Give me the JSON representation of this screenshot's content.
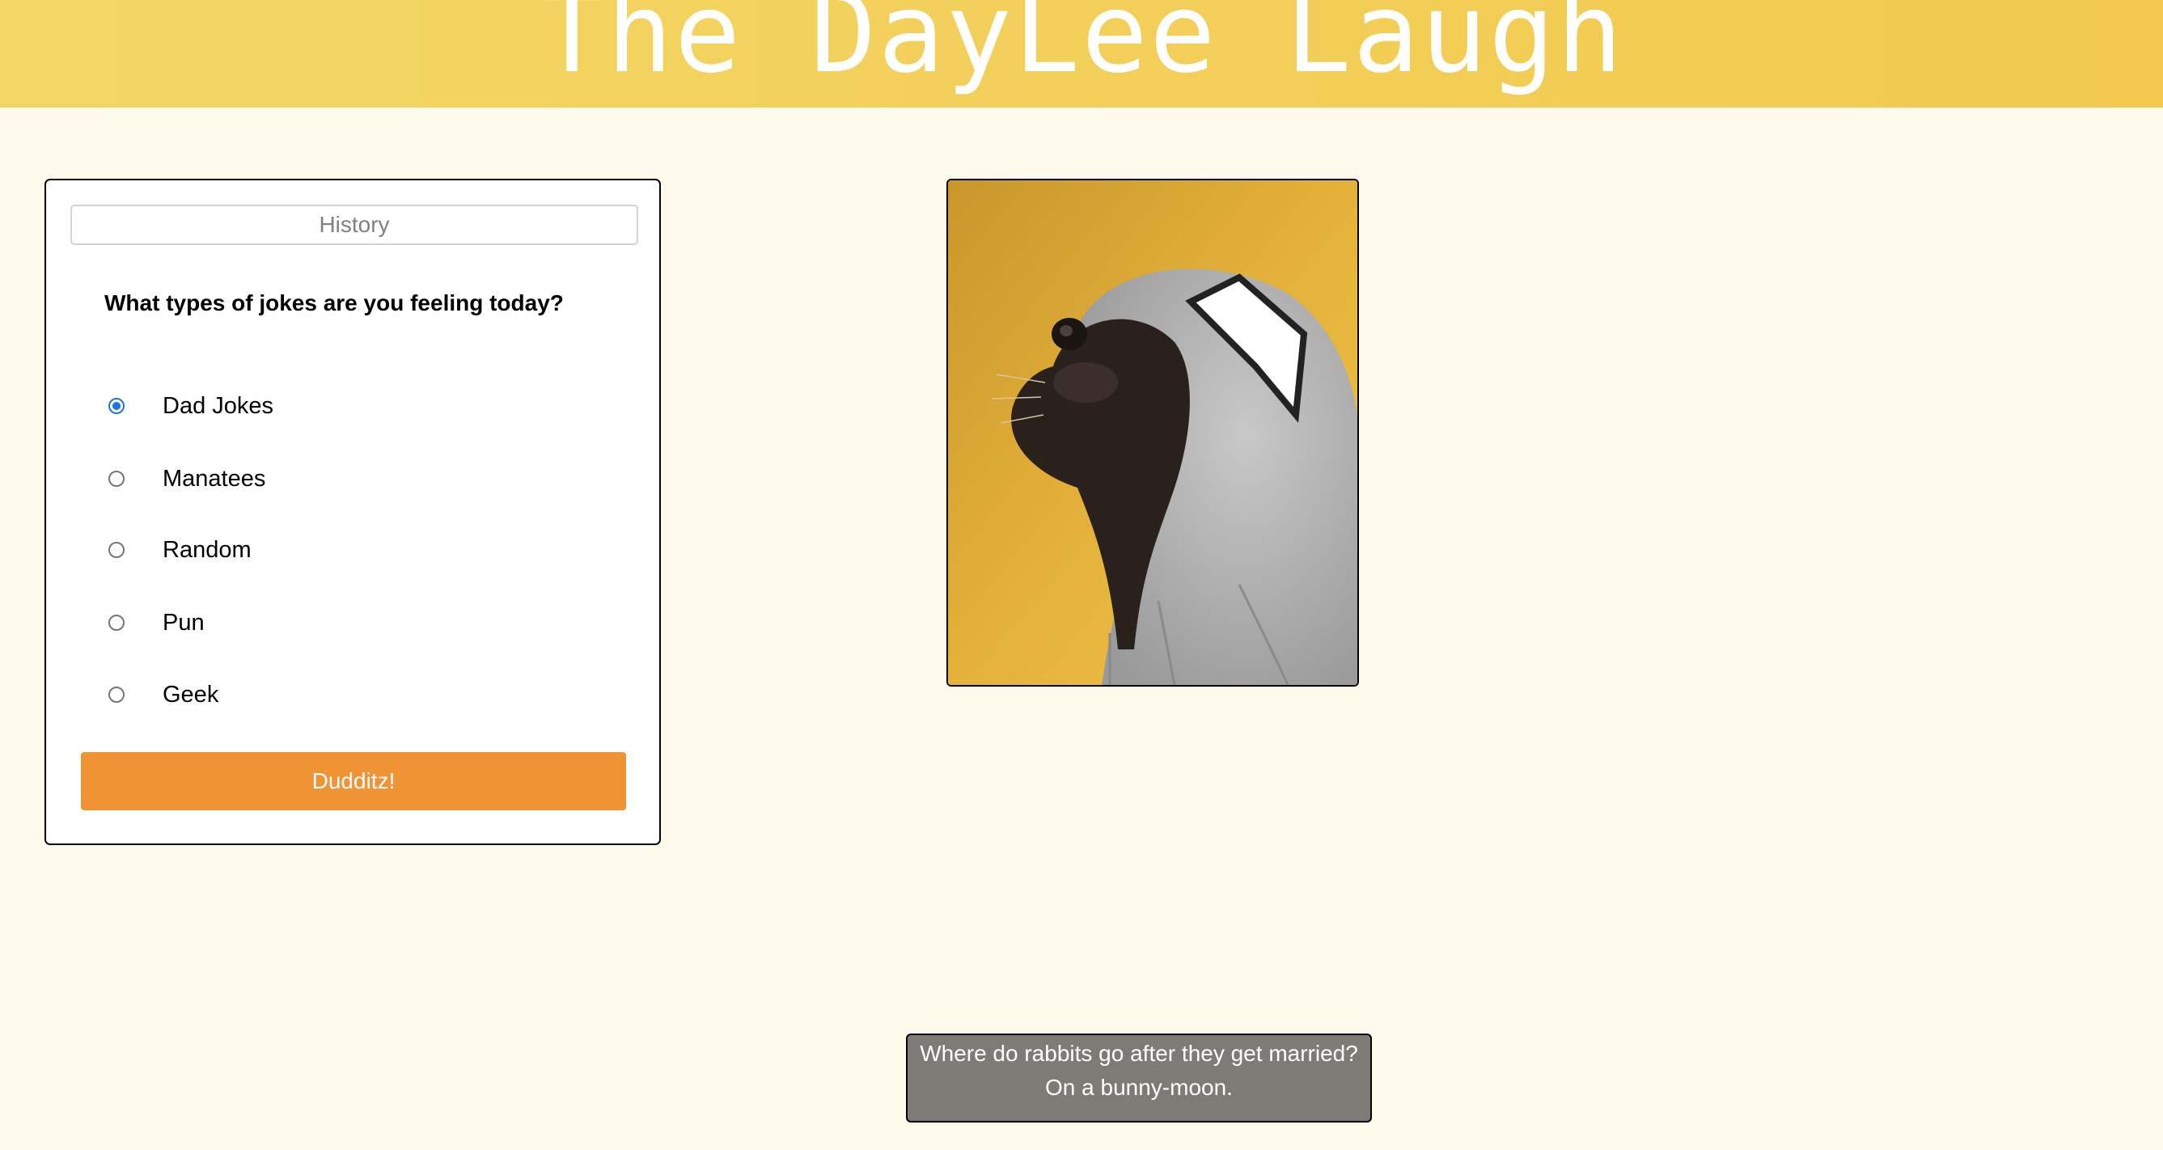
{
  "header": {
    "title": "The DayLee Laugh"
  },
  "sidebar": {
    "history_placeholder": "History",
    "question": "What types of jokes are you feeling today?",
    "options": [
      {
        "label": "Dad Jokes",
        "checked": true
      },
      {
        "label": "Manatees",
        "checked": false
      },
      {
        "label": "Random",
        "checked": false
      },
      {
        "label": "Pun",
        "checked": false
      },
      {
        "label": "Geek",
        "checked": false
      }
    ],
    "submit_label": "Dudditz!"
  },
  "photo": {
    "subject": "pug-in-hoodie-image",
    "background_color": "#e5b23a"
  },
  "joke": {
    "line1": "Where do rabbits go after they get married?",
    "line2": "On a bunny-moon."
  },
  "colors": {
    "header_start": "#f4d666",
    "header_end": "#f2c94e",
    "page_bg": "#fefaeb",
    "button": "#ef9335",
    "joke_bg": "#7e7b76",
    "radio_accent": "#1a73e8"
  }
}
